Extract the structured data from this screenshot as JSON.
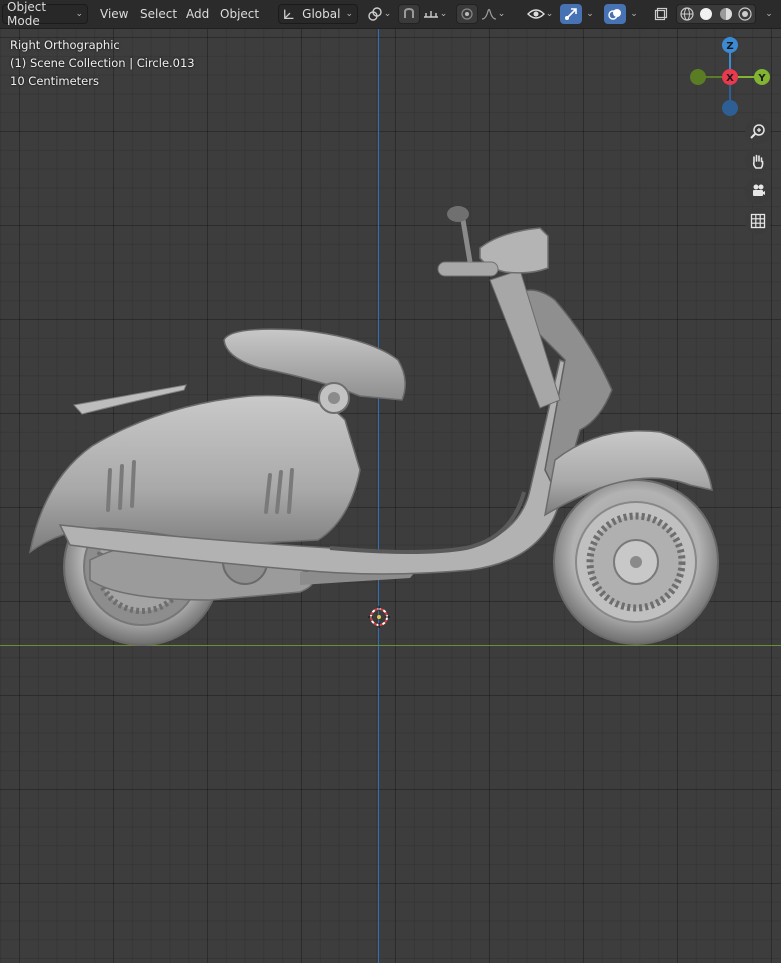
{
  "header": {
    "mode_label": "Object Mode",
    "menus": [
      "View",
      "Select",
      "Add",
      "Object"
    ],
    "orientation_label": "Global"
  },
  "viewport": {
    "view_name": "Right Orthographic",
    "collection_info": "(1) Scene Collection | Circle.013",
    "scale_label": "10 Centimeters"
  },
  "gizmo": {
    "z_label": "Z",
    "x_label": "X",
    "y_label": "Y",
    "colors": {
      "x": "#e8394e",
      "y": "#82b432",
      "z": "#3c8ad4"
    }
  },
  "icons": {
    "orientation": "transform-orientation-icon",
    "snap": "snap-icon",
    "proportional": "proportional-editing-icon",
    "visibility": "object-visibility-icon",
    "gizmo_toggle": "gizmo-toggle-icon",
    "overlay": "overlay-icon",
    "xray": "xray-icon",
    "shading": [
      "wireframe-icon",
      "solid-icon",
      "material-preview-icon",
      "rendered-icon"
    ],
    "nav": [
      "zoom-icon",
      "pan-hand-icon",
      "camera-icon",
      "grid-icon"
    ]
  }
}
